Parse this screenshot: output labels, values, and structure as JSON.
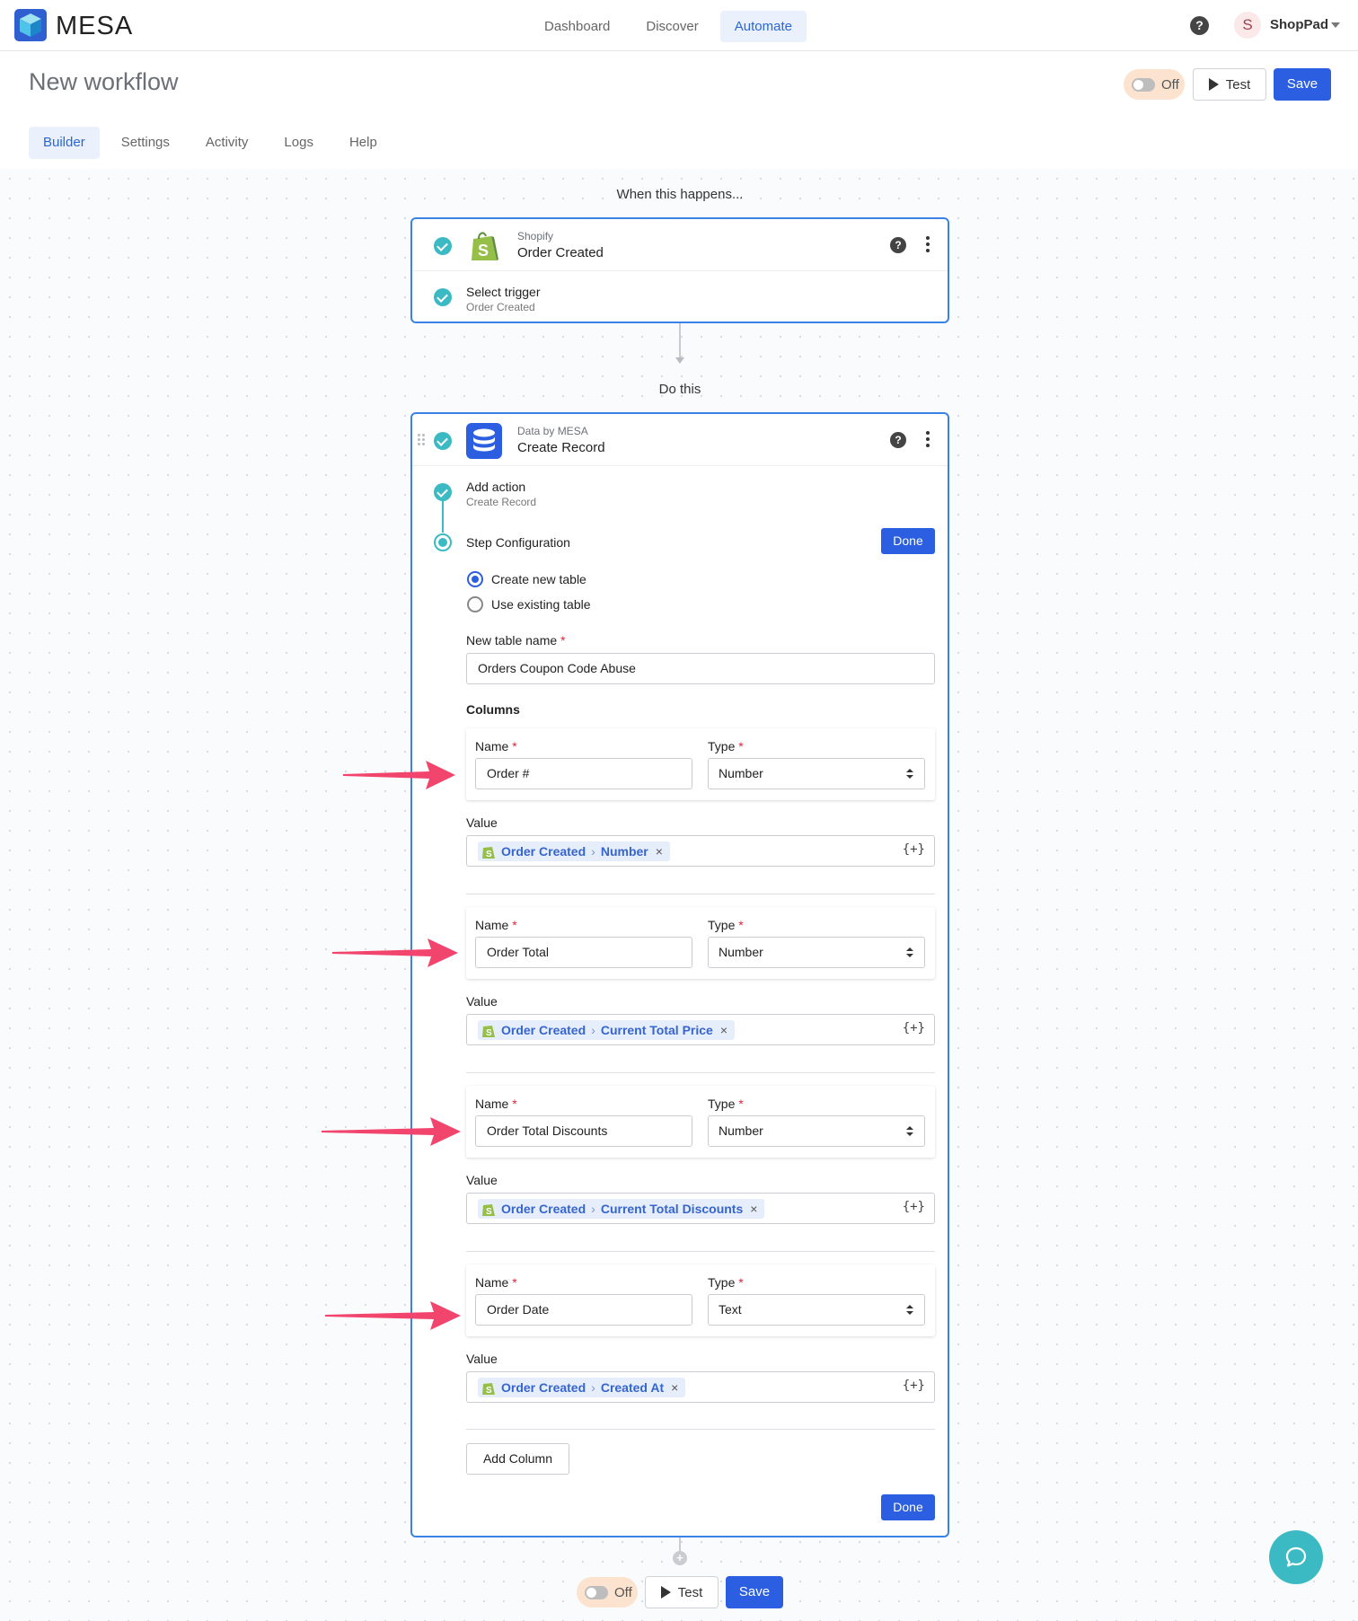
{
  "app": {
    "brand": "MESA",
    "nav": [
      "Dashboard",
      "Discover",
      "Automate"
    ],
    "active_nav": "Automate",
    "help_glyph": "?",
    "account": {
      "initial": "S",
      "name": "ShopPad"
    }
  },
  "header": {
    "title": "New workflow",
    "toggle_label": "Off",
    "test_label": "Test",
    "save_label": "Save"
  },
  "tabs": [
    "Builder",
    "Settings",
    "Activity",
    "Logs",
    "Help"
  ],
  "trigger": {
    "caption": "When this happens...",
    "app": "Shopify",
    "title": "Order Created",
    "step_label": "Select trigger",
    "step_value": "Order Created"
  },
  "action": {
    "caption": "Do this",
    "app": "Data by MESA",
    "title": "Create Record",
    "step1_label": "Add action",
    "step1_value": "Create Record",
    "step2_label": "Step Configuration",
    "done_label": "Done",
    "radio_options": [
      "Create new table",
      "Use existing table"
    ],
    "selected_radio": "Create new table",
    "table_name_label": "New table name",
    "table_name_value": "Orders Coupon Code Abuse",
    "required_mark": "*",
    "columns_title": "Columns",
    "name_label": "Name",
    "type_label": "Type",
    "value_label": "Value",
    "columns": [
      {
        "name": "Order #",
        "type": "Number",
        "source": "Order Created",
        "field": "Number"
      },
      {
        "name": "Order Total",
        "type": "Number",
        "source": "Order Created",
        "field": "Current Total Price"
      },
      {
        "name": "Order Total Discounts",
        "type": "Number",
        "source": "Order Created",
        "field": "Current Total Discounts"
      },
      {
        "name": "Order Date",
        "type": "Text",
        "source": "Order Created",
        "field": "Created At"
      }
    ],
    "chip_separator": "›",
    "chip_remove": "×",
    "variable_button": "{+}",
    "add_column_label": "Add Column"
  },
  "footer": {
    "toggle_label": "Off",
    "test_label": "Test",
    "save_label": "Save",
    "plus": "+"
  },
  "colors": {
    "accent": "#2b5ee0",
    "card_border": "#3b82e6",
    "check": "#3cbac4",
    "annotation_arrow": "#f2456e",
    "chip_bg": "#e7eefb",
    "shopify_green": "#95bf47"
  }
}
